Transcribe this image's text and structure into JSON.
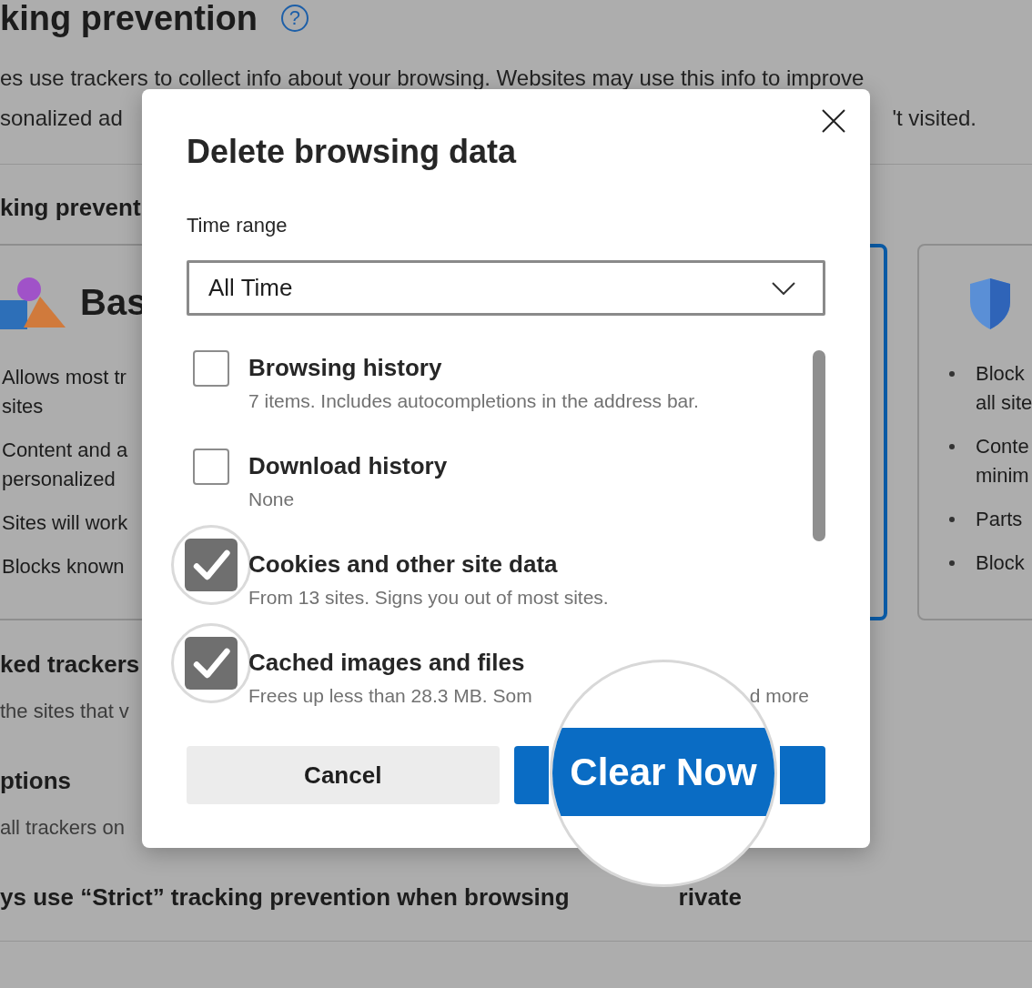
{
  "background": {
    "heading": "king prevention",
    "help_glyph": "?",
    "intro_lines": [
      {
        "left": "es use trackers to collect info about your browsing. Websites may use this info to improve"
      },
      {
        "left": "sonalized ad",
        "right": "'t visited."
      }
    ],
    "section_title": "king prevent",
    "cards": [
      {
        "kind": "basic",
        "selected": false,
        "title": "Bas",
        "bullets": [
          [
            "Allows most tr",
            "sites"
          ],
          [
            "Content and a",
            "personalized"
          ],
          [
            "Sites will work"
          ],
          [
            "Blocks known"
          ]
        ]
      },
      {
        "kind": "balanced",
        "selected": true
      },
      {
        "kind": "strict",
        "selected": false,
        "bullets": [
          [
            "Block",
            "all site"
          ],
          [
            "Conte",
            "minim"
          ],
          [
            "Parts"
          ],
          [
            "Block"
          ]
        ]
      }
    ],
    "rows": [
      {
        "kind": "heading",
        "text": "ked trackers"
      },
      {
        "kind": "text",
        "text": "the sites that v"
      },
      {
        "kind": "heading",
        "text": "ptions"
      },
      {
        "kind": "text",
        "text": "all trackers on"
      },
      {
        "kind": "heading",
        "text": "ys use “Strict” tracking prevention when browsing",
        "tail": "rivate"
      }
    ]
  },
  "dialog": {
    "title": "Delete browsing data",
    "time_range_label": "Time range",
    "time_range_value": "All Time",
    "items": [
      {
        "title": "Browsing history",
        "description": [
          "7 items. Includes autocompletions in the address bar."
        ],
        "checked": false,
        "magnified": false
      },
      {
        "title": "Download history",
        "description": [
          "None"
        ],
        "checked": false,
        "magnified": false
      },
      {
        "title": "Cookies and other site data",
        "description": [
          "From 13 sites. Signs you out of most sites."
        ],
        "checked": true,
        "magnified": true
      },
      {
        "title": "Cached images and files",
        "description": [
          "Frees up less than 28.3 MB. Som",
          "d more"
        ],
        "checked": true,
        "magnified": true
      }
    ],
    "buttons": [
      {
        "kind": "secondary",
        "label": "Cancel"
      },
      {
        "kind": "primary",
        "label": "Clear Now",
        "magnified": true
      }
    ]
  }
}
